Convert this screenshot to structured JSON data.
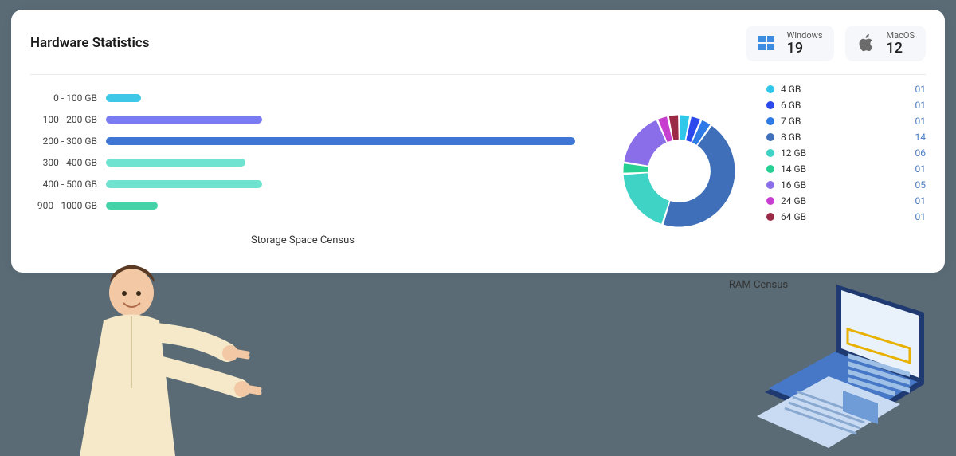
{
  "header": {
    "title": "Hardware Statistics",
    "os": [
      {
        "name": "Windows",
        "count": 19,
        "icon": "windows-icon"
      },
      {
        "name": "MacOS",
        "count": 12,
        "icon": "apple-icon"
      }
    ]
  },
  "storage": {
    "caption": "Storage Space Census",
    "bars": [
      {
        "label": "0 - 100 GB",
        "value": 2,
        "color": "#3fc7e8"
      },
      {
        "label": "100 - 200 GB",
        "value": 9,
        "color": "#7a7af2"
      },
      {
        "label": "200 - 300 GB",
        "value": 27,
        "color": "#3f76d6"
      },
      {
        "label": "300 - 400 GB",
        "value": 8,
        "color": "#6fe3d0"
      },
      {
        "label": "400 - 500 GB",
        "value": 9,
        "color": "#6fe3d0"
      },
      {
        "label": "900 - 1000 GB",
        "value": 3,
        "color": "#44d3a8"
      }
    ],
    "max": 27
  },
  "ram": {
    "caption": "RAM Census",
    "items": [
      {
        "label": "4 GB",
        "count": "01",
        "value": 1,
        "color": "#2fc7ea"
      },
      {
        "label": "6 GB",
        "count": "01",
        "value": 1,
        "color": "#2b49ec"
      },
      {
        "label": "7 GB",
        "count": "01",
        "value": 1,
        "color": "#2e7ae6"
      },
      {
        "label": "8 GB",
        "count": "14",
        "value": 14,
        "color": "#3e6fb8"
      },
      {
        "label": "12 GB",
        "count": "06",
        "value": 6,
        "color": "#3fd3c5"
      },
      {
        "label": "14 GB",
        "count": "01",
        "value": 1,
        "color": "#27cf93"
      },
      {
        "label": "16 GB",
        "count": "05",
        "value": 5,
        "color": "#8a6de8"
      },
      {
        "label": "24 GB",
        "count": "01",
        "value": 1,
        "color": "#c63fcf"
      },
      {
        "label": "64 GB",
        "count": "01",
        "value": 1,
        "color": "#9b2a46"
      }
    ]
  },
  "chart_data": [
    {
      "type": "bar",
      "orientation": "horizontal",
      "title": "Storage Space Census",
      "categories": [
        "0 - 100 GB",
        "100 - 200 GB",
        "200 - 300 GB",
        "300 - 400 GB",
        "400 - 500 GB",
        "900 - 1000 GB"
      ],
      "values": [
        2,
        9,
        27,
        8,
        9,
        3
      ],
      "xlabel": "",
      "ylabel": "",
      "ylim": [
        0,
        30
      ]
    },
    {
      "type": "pie",
      "title": "RAM Census",
      "categories": [
        "4 GB",
        "6 GB",
        "7 GB",
        "8 GB",
        "12 GB",
        "14 GB",
        "16 GB",
        "24 GB",
        "64 GB"
      ],
      "values": [
        1,
        1,
        1,
        14,
        6,
        1,
        5,
        1,
        1
      ],
      "xlabel": "",
      "ylabel": ""
    }
  ]
}
